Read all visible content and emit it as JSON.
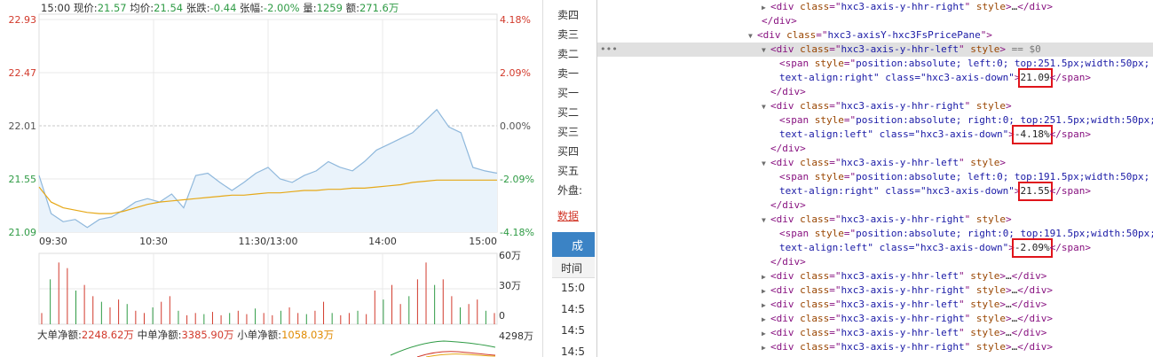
{
  "stock": {
    "info": {
      "time": "15:00",
      "price_label": "现价:",
      "price": "21.57",
      "avg_label": "均价:",
      "avg": "21.54",
      "change_label": "张跌:",
      "change": "-0.44",
      "pct_label": "张幅:",
      "pct": "-2.00%",
      "vol_label": "量:",
      "vol": "1259",
      "amount_label": "额:",
      "amount": "271.6万"
    },
    "price_axis_left": [
      "22.93",
      "22.47",
      "22.01",
      "21.55",
      "21.09"
    ],
    "price_axis_right": [
      "4.18%",
      "2.09%",
      "0.00%",
      "-2.09%",
      "-4.18%"
    ],
    "time_axis": [
      "09:30",
      "10:30",
      "11:30/13:00",
      "14:00",
      "15:00"
    ],
    "volume_axis": [
      "60万",
      "30万",
      "0"
    ],
    "flow": {
      "large_label": "大单净额:",
      "large": "2248.62万",
      "mid_label": "中单净额:",
      "mid": "3385.90万",
      "small_label": "小单净额:",
      "small": "1058.03万",
      "axis": "4298万"
    },
    "colors": {
      "up": "#d23a2c",
      "down": "#2f9b45",
      "price_line": "#8fb8dc",
      "avg_line": "#e6a817",
      "grid": "#e8e8e8"
    }
  },
  "chart_data": {
    "type": "line",
    "title": "",
    "xlabel": "",
    "ylabel": "",
    "ylim": [
      21.09,
      22.93
    ],
    "categories": [
      "09:30",
      "10:30",
      "11:30/13:00",
      "14:00",
      "15:00"
    ],
    "series": [
      {
        "values": [
          21.58,
          21.25,
          21.18,
          21.2,
          21.13,
          21.2,
          21.22,
          21.28,
          21.35,
          21.38,
          21.35,
          21.42,
          21.3,
          21.58,
          21.6,
          21.52,
          21.45,
          21.52,
          21.6,
          21.65,
          21.55,
          21.52,
          21.58,
          21.62,
          21.7,
          21.65,
          21.62,
          21.7,
          21.8,
          21.85,
          21.9,
          21.95,
          22.05,
          22.15,
          22.0,
          21.95,
          21.65,
          21.62,
          21.6
        ]
      },
      {
        "values": [
          21.48,
          21.35,
          21.3,
          21.28,
          21.26,
          21.25,
          21.25,
          21.27,
          21.3,
          21.33,
          21.35,
          21.36,
          21.37,
          21.38,
          21.39,
          21.4,
          21.41,
          21.41,
          21.42,
          21.43,
          21.43,
          21.44,
          21.45,
          21.45,
          21.46,
          21.46,
          21.47,
          21.47,
          21.48,
          21.49,
          21.5,
          21.52,
          21.53,
          21.54,
          21.54,
          21.54,
          21.54,
          21.54,
          21.54
        ]
      }
    ],
    "volume": [
      10,
      40,
      55,
      50,
      30,
      35,
      25,
      20,
      15,
      22,
      18,
      12,
      10,
      15,
      20,
      25,
      12,
      8,
      10,
      9,
      11,
      8,
      10,
      12,
      9,
      14,
      10,
      8,
      12,
      15,
      10,
      9,
      12,
      20,
      10,
      8,
      10,
      12,
      9,
      30,
      22,
      35,
      18,
      25,
      40,
      55,
      35,
      40,
      25,
      15,
      18,
      22,
      12,
      10
    ]
  },
  "book": {
    "rows": [
      "卖四",
      "卖三",
      "卖二",
      "卖一",
      "买一",
      "买二",
      "买三",
      "买四",
      "买五",
      "外盘:"
    ],
    "data_link": "数据",
    "tab": "成",
    "time_header": "时间",
    "times": [
      "15:0",
      "14:5",
      "14:5",
      "14:5"
    ]
  },
  "devtools": {
    "l1_tag": "div",
    "l1_class": "hxc3-axis-y-hhr-right",
    "l1_attr": "style",
    "l1_ellipsis": "…",
    "l2": "</div>",
    "l3_tag": "div",
    "l3_class": "hxc3-axisY-hxc3FsPricePane",
    "l4_class": "hxc3-axis-y-hhr-left",
    "l4_attr": "style",
    "l4_marker": "== $0",
    "blocks": [
      {
        "span_style_1": "position:absolute; left:0; top:251.5px;width:50px;",
        "span_style_2": "text-align:right\" class=\"hxc3-axis-down\"",
        "value": "21.09"
      },
      {
        "div_class": "hxc3-axis-y-hhr-right",
        "span_style_1": "position:absolute; right:0; top:251.5px;width:50px;",
        "span_style_2": "text-align:left\" class=\"hxc3-axis-down\"",
        "value": "-4.18%"
      },
      {
        "div_class": "hxc3-axis-y-hhr-left",
        "span_style_1": "position:absolute; left:0; top:191.5px;width:50px;",
        "span_style_2": "text-align:right\" class=\"hxc3-axis-down\"",
        "value": "21.55"
      },
      {
        "div_class": "hxc3-axis-y-hhr-right",
        "span_style_1": "position:absolute; right:0; top:191.5px;width:50px;",
        "span_style_2": "text-align:left\" class=\"hxc3-axis-down\"",
        "value": "-2.09%"
      }
    ],
    "collapsed": [
      "hxc3-axis-y-hhr-left",
      "hxc3-axis-y-hhr-right",
      "hxc3-axis-y-hhr-left",
      "hxc3-axis-y-hhr-right",
      "hxc3-axis-y-hhr-left",
      "hxc3-axis-y-hhr-right"
    ],
    "div_close": "</div>",
    "span_close": "</span>"
  }
}
